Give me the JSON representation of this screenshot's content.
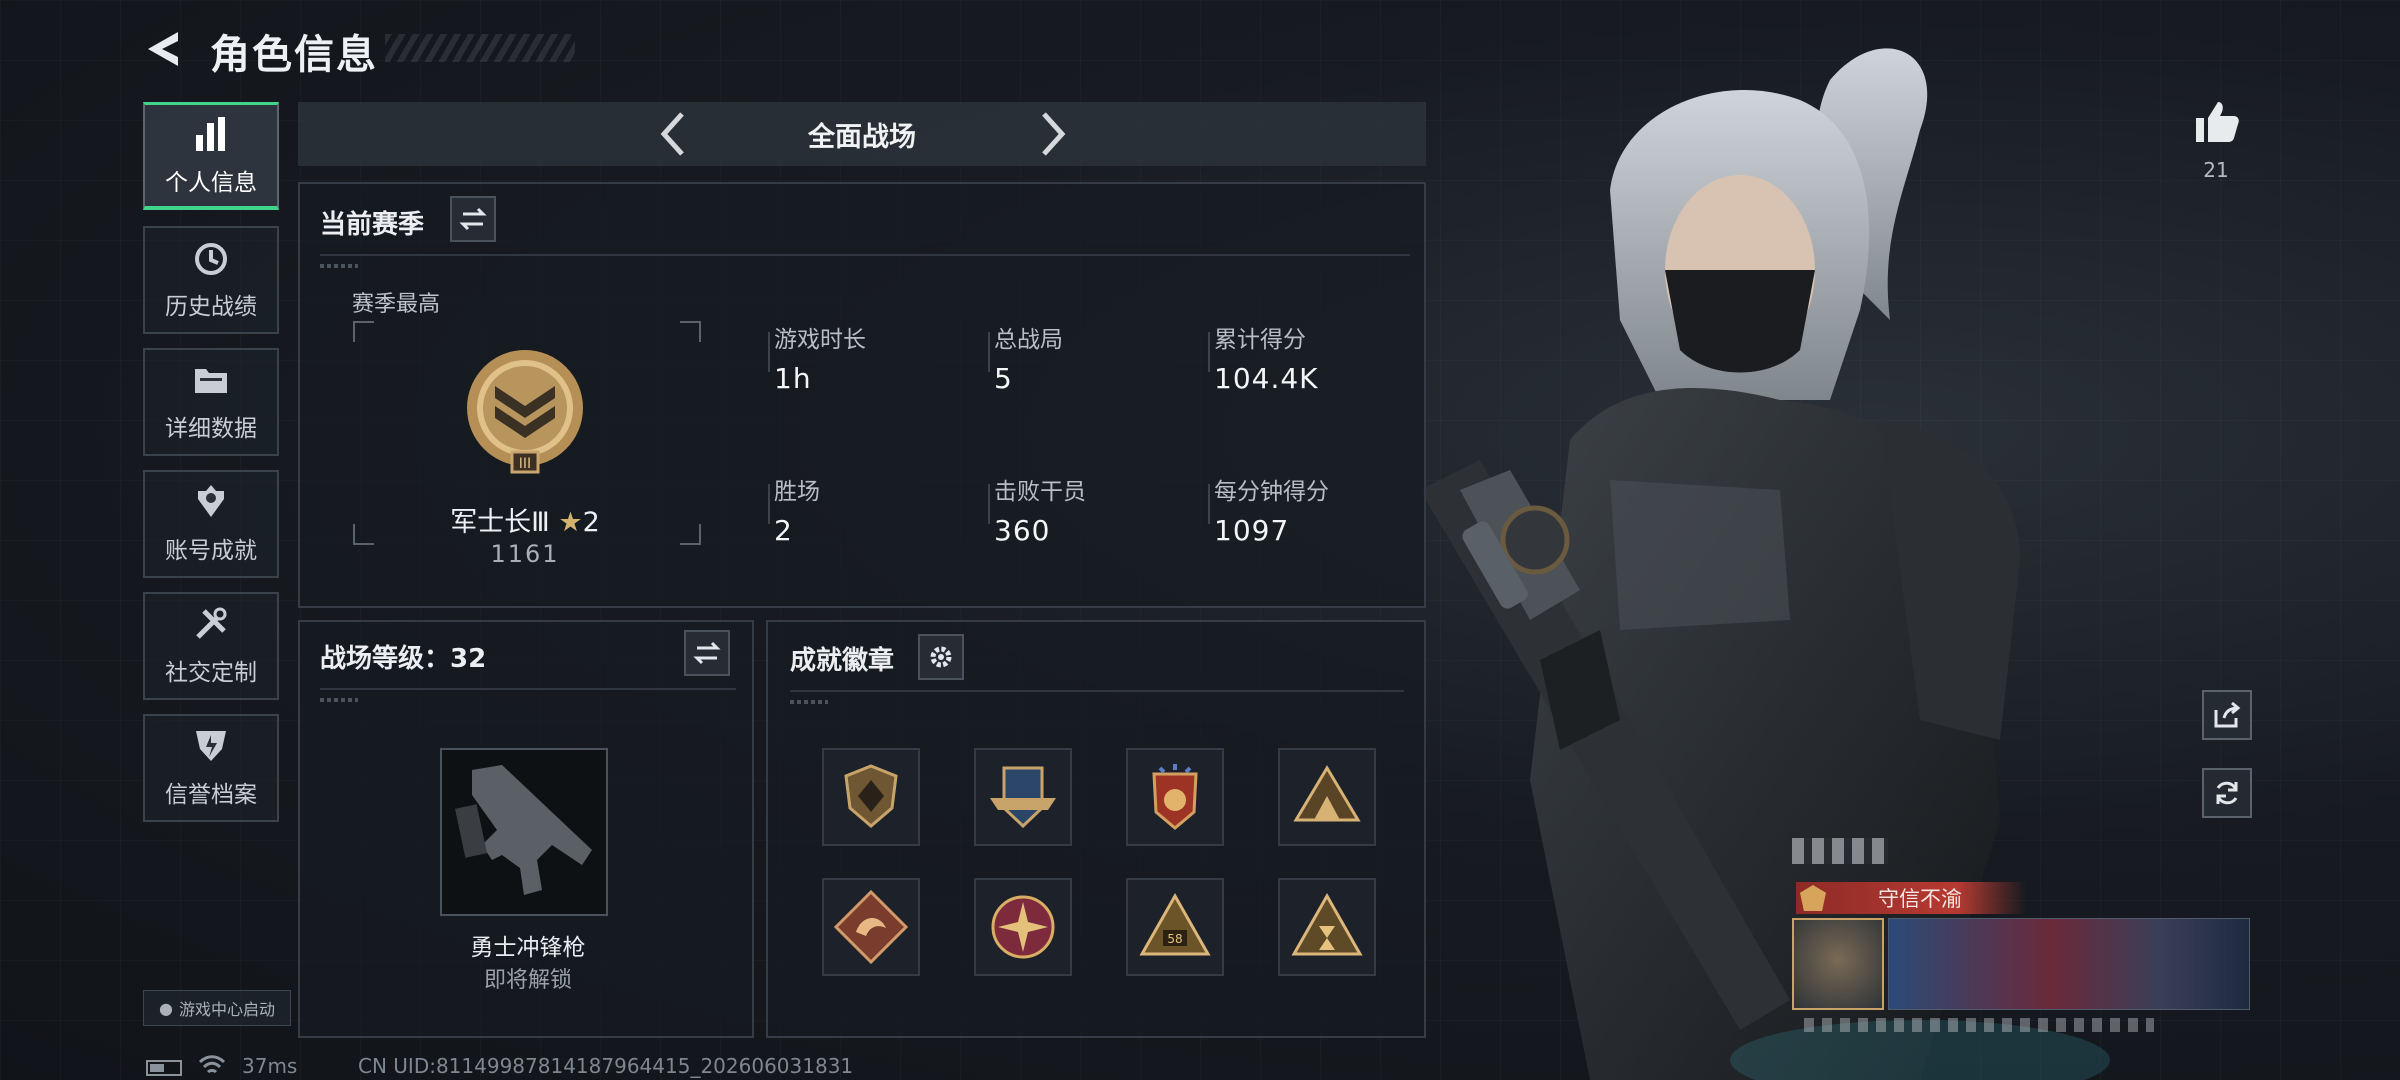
{
  "header": {
    "title": "角色信息"
  },
  "sidebar": {
    "items": [
      {
        "label": "个人信息",
        "icon": "bar-chart-icon",
        "active": true
      },
      {
        "label": "历史战绩",
        "icon": "history-clock-icon",
        "active": false
      },
      {
        "label": "详细数据",
        "icon": "folder-icon",
        "active": false
      },
      {
        "label": "账号成就",
        "icon": "achievement-icon",
        "active": false
      },
      {
        "label": "社交定制",
        "icon": "tools-icon",
        "active": false
      },
      {
        "label": "信誉档案",
        "icon": "credit-shield-icon",
        "active": false
      }
    ],
    "launch_label": "游戏中心启动"
  },
  "mode": {
    "title": "全面战场"
  },
  "season": {
    "heading": "当前赛季",
    "best_label": "赛季最高",
    "rank_name": "军士长Ⅲ",
    "rank_stars": "2",
    "rank_points": "1161",
    "stats": [
      {
        "label": "游戏时长",
        "value": "1h"
      },
      {
        "label": "总战局",
        "value": "5"
      },
      {
        "label": "累计得分",
        "value": "104.4K"
      },
      {
        "label": "胜场",
        "value": "2"
      },
      {
        "label": "击败干员",
        "value": "360"
      },
      {
        "label": "每分钟得分",
        "value": "1097"
      }
    ]
  },
  "level": {
    "heading": "战场等级：32",
    "weapon_name": "勇士冲锋枪",
    "weapon_status": "即将解锁"
  },
  "badges": {
    "heading": "成就徽章",
    "items": [
      "shield-badge-icon",
      "wings-badge-icon",
      "star-badge-icon",
      "tent-badge-icon",
      "dragon-badge-icon",
      "cross-badge-icon",
      "number-58-badge-icon",
      "timer-badge-icon"
    ]
  },
  "likes": {
    "count": "21"
  },
  "reputation": {
    "label": "守信不渝"
  },
  "footer": {
    "ping": "37ms",
    "uid": "CN UID:81149987814187964415_202606031831"
  },
  "colors": {
    "accent": "#3fd58a",
    "panel_border": "#353c45",
    "rep_red": "#8e2a26"
  }
}
